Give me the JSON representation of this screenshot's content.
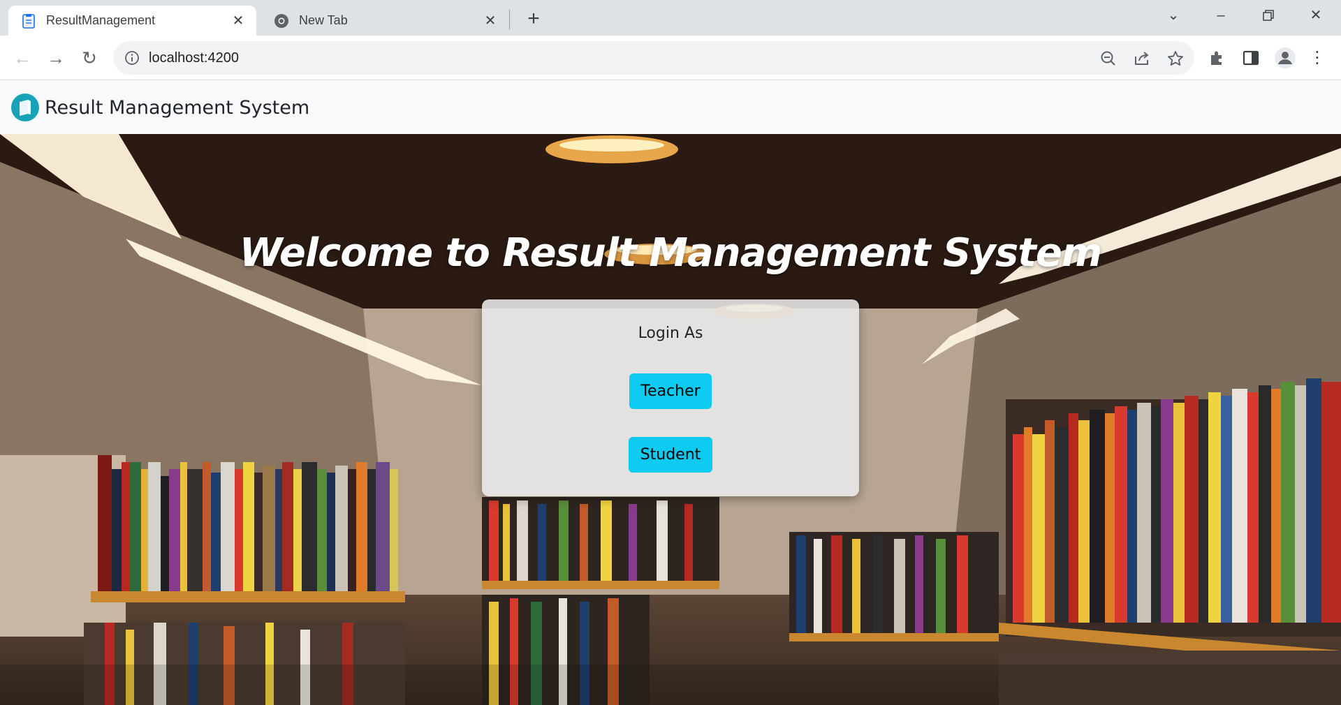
{
  "browser": {
    "tabs": [
      {
        "title": "ResultManagement",
        "active": true
      },
      {
        "title": "New Tab",
        "active": false
      }
    ],
    "url": "localhost:4200"
  },
  "navbar": {
    "brand": "Result Management System",
    "brand_color": "#17a2b8"
  },
  "hero": {
    "welcome": "Welcome to Result Management System"
  },
  "login": {
    "heading": "Login As",
    "buttons": [
      "Teacher",
      "Student"
    ],
    "button_color": "#0dcaf0"
  }
}
